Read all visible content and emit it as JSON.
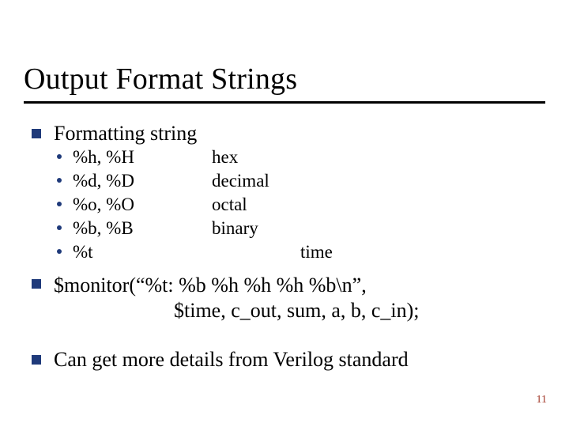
{
  "title": "Output Format Strings",
  "section1": {
    "heading": "Formatting string",
    "rows": [
      {
        "fmt": "%h, %H",
        "desc": "hex"
      },
      {
        "fmt": "%d, %D",
        "desc": "decimal"
      },
      {
        "fmt": "%o, %O",
        "desc": "octal"
      },
      {
        "fmt": "%b, %B",
        "desc": "binary"
      },
      {
        "fmt": "%t",
        "desc": "time"
      }
    ]
  },
  "section2": {
    "line1": "$monitor(“%t: %b %h %h %h %b\\n”,",
    "line2": "$time, c_out, sum, a, b, c_in);"
  },
  "section3": "Can get more details from Verilog standard",
  "page_number": "11"
}
